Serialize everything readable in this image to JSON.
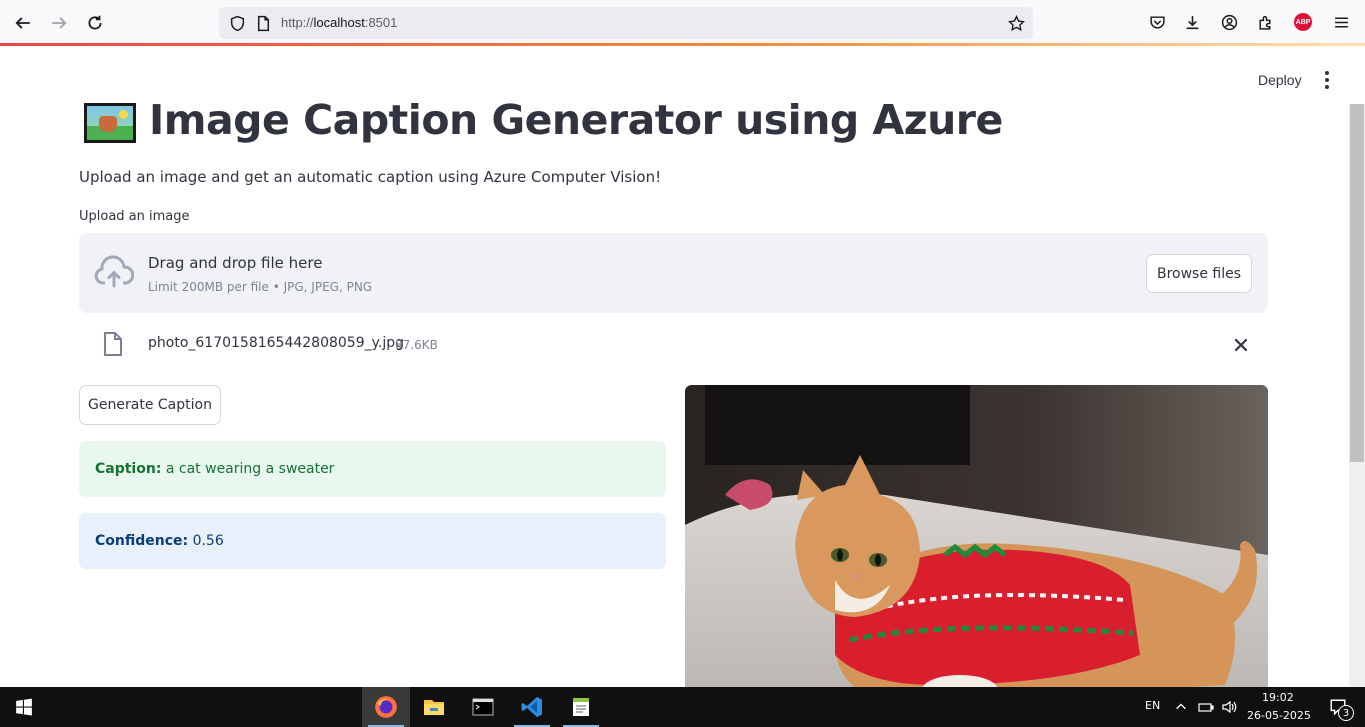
{
  "browser": {
    "url_prefix": "http://",
    "url_host": "localhost",
    "url_port": ":8501",
    "abp_label": "ABP"
  },
  "app": {
    "deploy_label": "Deploy",
    "title": "Image Caption Generator using Azure",
    "subtitle": "Upload an image and get an automatic caption using Azure Computer Vision!",
    "uploader": {
      "label": "Upload an image",
      "drop_text": "Drag and drop file here",
      "limit_text": "Limit 200MB per file • JPG, JPEG, PNG",
      "browse_label": "Browse files"
    },
    "file": {
      "name": "photo_6170158165442808059_y.jpg",
      "size": "87.6KB"
    },
    "generate_label": "Generate Caption",
    "caption": {
      "label": "Caption:",
      "value": "a cat wearing a sweater"
    },
    "confidence": {
      "label": "Confidence:",
      "value": "0.56"
    }
  },
  "taskbar": {
    "language": "EN",
    "time": "19:02",
    "date": "26-05-2025",
    "notification_count": "3"
  },
  "colors": {
    "success_bg": "#e9f8ee",
    "success_text": "#177233",
    "info_bg": "#e7f0fb",
    "info_text": "#0a3d7a",
    "text": "#31333f"
  }
}
